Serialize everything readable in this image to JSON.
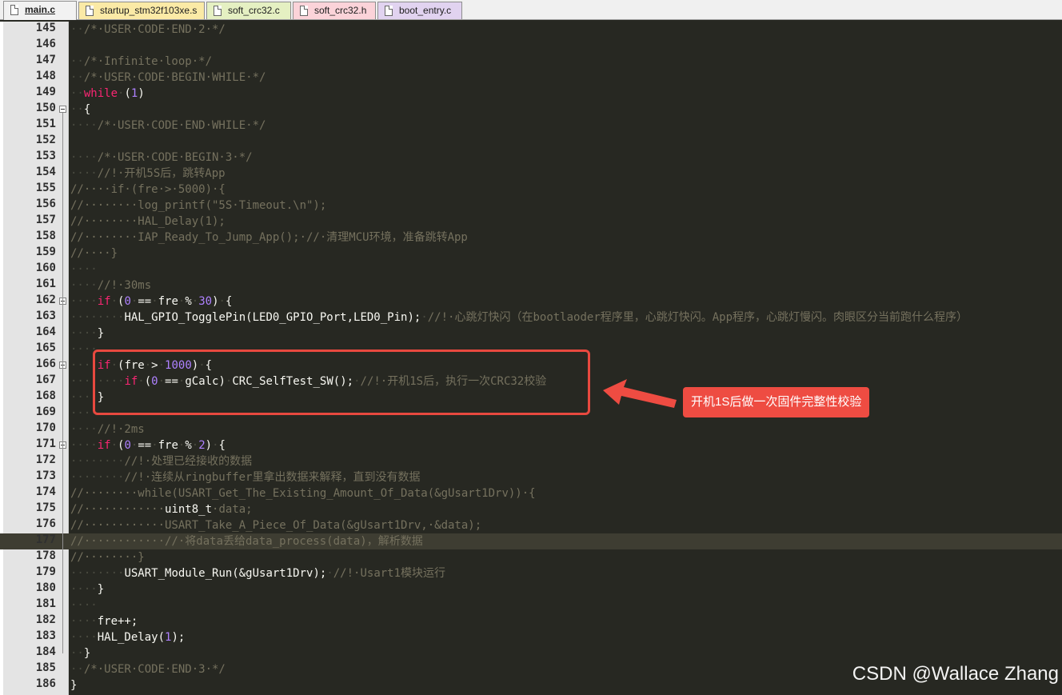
{
  "tabs": [
    {
      "label": "main.c",
      "color": "#f2f2f2",
      "active": true
    },
    {
      "label": "startup_stm32f103xe.s",
      "color": "#fbeaa6",
      "active": false
    },
    {
      "label": "soft_crc32.c",
      "color": "#e5f0c2",
      "active": false
    },
    {
      "label": "soft_crc32.h",
      "color": "#fbd3d9",
      "active": false
    },
    {
      "label": "boot_entry.c",
      "color": "#e1d3f0",
      "active": false
    }
  ],
  "editor": {
    "lines": [
      {
        "n": "145",
        "tokens": [
          [
            "ws",
            "··"
          ],
          [
            "cm",
            "/*·USER·CODE·END·2·*/"
          ]
        ]
      },
      {
        "n": "146",
        "tokens": []
      },
      {
        "n": "147",
        "tokens": [
          [
            "ws",
            "··"
          ],
          [
            "cm",
            "/*·Infinite·loop·*/"
          ]
        ]
      },
      {
        "n": "148",
        "tokens": [
          [
            "ws",
            "··"
          ],
          [
            "cm",
            "/*·USER·CODE·BEGIN·WHILE·*/"
          ]
        ]
      },
      {
        "n": "149",
        "tokens": [
          [
            "ws",
            "··"
          ],
          [
            "kw",
            "while"
          ],
          [
            "ws",
            "·"
          ],
          [
            "op",
            "("
          ],
          [
            "num",
            "1"
          ],
          [
            "op",
            ")"
          ]
        ]
      },
      {
        "n": "150",
        "fold": true,
        "tokens": [
          [
            "ws",
            "··"
          ],
          [
            "op",
            "{"
          ]
        ]
      },
      {
        "n": "151",
        "tokens": [
          [
            "ws",
            "····"
          ],
          [
            "cm",
            "/*·USER·CODE·END·WHILE·*/"
          ]
        ]
      },
      {
        "n": "152",
        "tokens": []
      },
      {
        "n": "153",
        "tokens": [
          [
            "ws",
            "····"
          ],
          [
            "cm",
            "/*·USER·CODE·BEGIN·3·*/"
          ]
        ]
      },
      {
        "n": "154",
        "tokens": [
          [
            "ws",
            "····"
          ],
          [
            "cm",
            "//!·开机5S后，跳转App"
          ]
        ]
      },
      {
        "n": "155",
        "tokens": [
          [
            "cm",
            "//····if·(fre·>·5000)·{"
          ]
        ]
      },
      {
        "n": "156",
        "tokens": [
          [
            "cm",
            "//········log_printf(\"5S·Timeout.\\n\");"
          ]
        ]
      },
      {
        "n": "157",
        "tokens": [
          [
            "cm",
            "//········HAL_Delay(1);"
          ]
        ]
      },
      {
        "n": "158",
        "tokens": [
          [
            "cm",
            "//········IAP_Ready_To_Jump_App();·//·清理MCU环境，准备跳转App"
          ]
        ]
      },
      {
        "n": "159",
        "tokens": [
          [
            "cm",
            "//····}"
          ]
        ]
      },
      {
        "n": "160",
        "tokens": [
          [
            "ws",
            "····"
          ]
        ]
      },
      {
        "n": "161",
        "tokens": [
          [
            "ws",
            "····"
          ],
          [
            "cm",
            "//!·30ms"
          ]
        ]
      },
      {
        "n": "162",
        "fold": true,
        "tokens": [
          [
            "ws",
            "····"
          ],
          [
            "kw",
            "if"
          ],
          [
            "ws",
            "·"
          ],
          [
            "op",
            "("
          ],
          [
            "num",
            "0"
          ],
          [
            "ws",
            "·"
          ],
          [
            "op",
            "=="
          ],
          [
            "ws",
            "·"
          ],
          [
            "id",
            "fre"
          ],
          [
            "ws",
            "·"
          ],
          [
            "op",
            "%"
          ],
          [
            "ws",
            "·"
          ],
          [
            "num",
            "30"
          ],
          [
            "op",
            ")"
          ],
          [
            "ws",
            "·"
          ],
          [
            "op",
            "{"
          ]
        ]
      },
      {
        "n": "163",
        "tokens": [
          [
            "ws",
            "········"
          ],
          [
            "id",
            "HAL_GPIO_TogglePin(LED0_GPIO_Port,LED0_Pin);"
          ],
          [
            "ws",
            "·"
          ],
          [
            "cm",
            "//!·心跳灯快闪（在bootlaoder程序里，心跳灯快闪。App程序，心跳灯慢闪。肉眼区分当前跑什么程序）"
          ]
        ]
      },
      {
        "n": "164",
        "tokens": [
          [
            "ws",
            "····"
          ],
          [
            "op",
            "}"
          ]
        ]
      },
      {
        "n": "165",
        "tokens": [
          [
            "ws",
            "····"
          ]
        ]
      },
      {
        "n": "166",
        "fold": true,
        "tokens": [
          [
            "ws",
            "····"
          ],
          [
            "kw",
            "if"
          ],
          [
            "ws",
            "·"
          ],
          [
            "op",
            "(fre"
          ],
          [
            "ws",
            "·"
          ],
          [
            "op",
            ">"
          ],
          [
            "ws",
            "·"
          ],
          [
            "num",
            "1000"
          ],
          [
            "op",
            ")"
          ],
          [
            "ws",
            "·"
          ],
          [
            "op",
            "{"
          ]
        ]
      },
      {
        "n": "167",
        "tokens": [
          [
            "ws",
            "········"
          ],
          [
            "kw",
            "if"
          ],
          [
            "ws",
            "·"
          ],
          [
            "op",
            "("
          ],
          [
            "num",
            "0"
          ],
          [
            "ws",
            "·"
          ],
          [
            "op",
            "=="
          ],
          [
            "ws",
            "·"
          ],
          [
            "id",
            "gCalc)"
          ],
          [
            "ws",
            "·"
          ],
          [
            "id",
            "CRC_SelfTest_SW();"
          ],
          [
            "ws",
            "·"
          ],
          [
            "cm",
            "//!·开机1S后，执行一次CRC32校验"
          ]
        ]
      },
      {
        "n": "168",
        "tokens": [
          [
            "ws",
            "····"
          ],
          [
            "op",
            "}"
          ]
        ]
      },
      {
        "n": "169",
        "tokens": [
          [
            "ws",
            "····"
          ]
        ]
      },
      {
        "n": "170",
        "tokens": [
          [
            "ws",
            "····"
          ],
          [
            "cm",
            "//!·2ms"
          ]
        ]
      },
      {
        "n": "171",
        "fold": true,
        "tokens": [
          [
            "ws",
            "····"
          ],
          [
            "kw",
            "if"
          ],
          [
            "ws",
            "·"
          ],
          [
            "op",
            "("
          ],
          [
            "num",
            "0"
          ],
          [
            "ws",
            "·"
          ],
          [
            "op",
            "=="
          ],
          [
            "ws",
            "·"
          ],
          [
            "id",
            "fre"
          ],
          [
            "ws",
            "·"
          ],
          [
            "op",
            "%"
          ],
          [
            "ws",
            "·"
          ],
          [
            "num",
            "2"
          ],
          [
            "op",
            ")"
          ],
          [
            "ws",
            "·"
          ],
          [
            "op",
            "{"
          ]
        ]
      },
      {
        "n": "172",
        "tokens": [
          [
            "ws",
            "········"
          ],
          [
            "cm",
            "//!·处理已经接收的数据"
          ]
        ]
      },
      {
        "n": "173",
        "tokens": [
          [
            "ws",
            "········"
          ],
          [
            "cm",
            "//!·连续从ringbuffer里拿出数据来解释，直到没有数据"
          ]
        ]
      },
      {
        "n": "174",
        "tokens": [
          [
            "cm",
            "//········while(USART_Get_The_Existing_Amount_Of_Data(&gUsart1Drv))·{"
          ]
        ]
      },
      {
        "n": "175",
        "tokens": [
          [
            "cm",
            "//············"
          ],
          [
            "id",
            "uint8_t"
          ],
          [
            "cm",
            "·data;"
          ]
        ]
      },
      {
        "n": "176",
        "tokens": [
          [
            "cm",
            "//············USART_Take_A_Piece_Of_Data(&gUsart1Drv,·&data);"
          ]
        ]
      },
      {
        "n": "177",
        "highlight": true,
        "tokens": [
          [
            "cm",
            "//············//·将data丢给data_process(data)，解析数据"
          ]
        ]
      },
      {
        "n": "178",
        "tokens": [
          [
            "cm",
            "//········}"
          ]
        ]
      },
      {
        "n": "179",
        "tokens": [
          [
            "ws",
            "········"
          ],
          [
            "id",
            "USART_Module_Run(&gUsart1Drv);"
          ],
          [
            "ws",
            "·"
          ],
          [
            "cm",
            "//!·Usart1模块运行"
          ]
        ]
      },
      {
        "n": "180",
        "tokens": [
          [
            "ws",
            "····"
          ],
          [
            "op",
            "}"
          ]
        ]
      },
      {
        "n": "181",
        "tokens": [
          [
            "ws",
            "····"
          ]
        ]
      },
      {
        "n": "182",
        "tokens": [
          [
            "ws",
            "····"
          ],
          [
            "id",
            "fre++;"
          ]
        ]
      },
      {
        "n": "183",
        "tokens": [
          [
            "ws",
            "····"
          ],
          [
            "id",
            "HAL_Delay("
          ],
          [
            "num",
            "1"
          ],
          [
            "id",
            ");"
          ]
        ]
      },
      {
        "n": "184",
        "tokens": [
          [
            "ws",
            "··"
          ],
          [
            "op",
            "}"
          ]
        ]
      },
      {
        "n": "185",
        "tokens": [
          [
            "ws",
            "··"
          ],
          [
            "cm",
            "/*·USER·CODE·END·3·*/"
          ]
        ]
      },
      {
        "n": "186",
        "tokens": [
          [
            "op",
            "}"
          ]
        ]
      }
    ]
  },
  "annotation": {
    "label": "开机1S后做一次固件完整性校验",
    "color": "#ee4c42"
  },
  "watermark": "CSDN @Wallace Zhang"
}
